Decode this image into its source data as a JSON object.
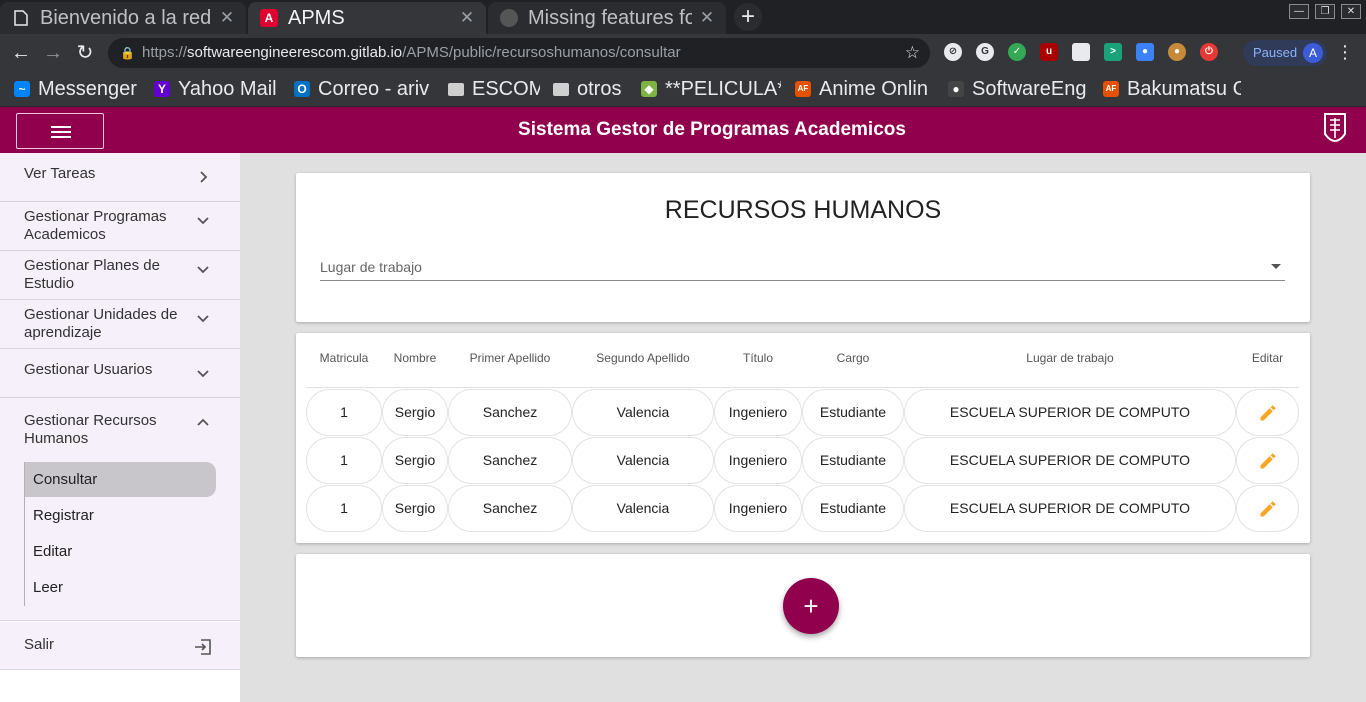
{
  "browser": {
    "tabs": [
      {
        "title": "Bienvenido a la red",
        "state": "inactive",
        "icon": "document-icon"
      },
      {
        "title": "APMS",
        "state": "active",
        "icon": "angular-icon"
      },
      {
        "title": "Missing features fo",
        "state": "inactive",
        "icon": "github-icon"
      }
    ],
    "new_tab": "+",
    "url": {
      "scheme": "https://",
      "host": "softwareengineerescom.gitlab.io",
      "path": "/APMS/public/recursoshumanos/consultar"
    },
    "profile": {
      "status": "Paused",
      "initial": "A"
    },
    "bookmarks": [
      {
        "label": "Messenger",
        "icon": "messenger-icon",
        "color": "#0084ff",
        "glyph": "~"
      },
      {
        "label": "Yahoo Mail",
        "icon": "yahoo-icon",
        "color": "#6001d2",
        "glyph": "Y"
      },
      {
        "label": "Correo - ariv",
        "icon": "outlook-icon",
        "color": "#0072c6",
        "glyph": "O"
      },
      {
        "label": "ESCOM",
        "icon": "folder-icon",
        "color": "#cfcfcf",
        "glyph": ""
      },
      {
        "label": "otros",
        "icon": "folder-icon",
        "color": "#cfcfcf",
        "glyph": ""
      },
      {
        "label": "**PELICULA*",
        "icon": "diamond-icon",
        "color": "#7cb342",
        "glyph": "◆"
      },
      {
        "label": "Anime Onlin",
        "icon": "af-icon",
        "color": "#e65100",
        "glyph": "AF"
      },
      {
        "label": "SoftwareEng",
        "icon": "github-icon",
        "color": "#444",
        "glyph": "●"
      },
      {
        "label": "Bakumatsu G",
        "icon": "af-icon",
        "color": "#e65100",
        "glyph": "AF"
      }
    ]
  },
  "app": {
    "title": "Sistema Gestor de Programas Academicos",
    "primary_color": "#91004d",
    "sidebar": {
      "items": [
        {
          "label": "Ver Tareas",
          "chevron": "right"
        },
        {
          "label": "Gestionar Programas Academicos",
          "chevron": "down"
        },
        {
          "label": "Gestionar Planes de Estudio",
          "chevron": "down"
        },
        {
          "label": "Gestionar Unidades de aprendizaje",
          "chevron": "down"
        },
        {
          "label": "Gestionar Usuarios",
          "chevron": "down"
        },
        {
          "label": "Gestionar Recursos Humanos",
          "chevron": "up"
        }
      ],
      "subitems": [
        "Consultar",
        "Registrar",
        "Editar",
        "Leer"
      ],
      "active_subitem": "Consultar",
      "logout": "Salir"
    },
    "page_title": "RECURSOS HUMANOS",
    "filter": {
      "placeholder": "Lugar de trabajo"
    },
    "table": {
      "columns": [
        "Matricula",
        "Nombre",
        "Primer Apellido",
        "Segundo Apellido",
        "Título",
        "Cargo",
        "Lugar de trabajo",
        "Editar"
      ],
      "rows": [
        [
          "1",
          "Sergio",
          "Sanchez",
          "Valencia",
          "Ingeniero",
          "Estudiante",
          "ESCUELA SUPERIOR DE COMPUTO"
        ],
        [
          "1",
          "Sergio",
          "Sanchez",
          "Valencia",
          "Ingeniero",
          "Estudiante",
          "ESCUELA SUPERIOR DE COMPUTO"
        ],
        [
          "1",
          "Sergio",
          "Sanchez",
          "Valencia",
          "Ingeniero",
          "Estudiante",
          "ESCUELA SUPERIOR DE COMPUTO"
        ]
      ],
      "edit_icon_color": "#f9a825"
    },
    "add_button": "+"
  }
}
